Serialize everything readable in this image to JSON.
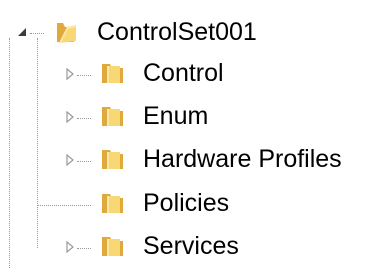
{
  "tree": {
    "root": {
      "label": "ControlSet001",
      "expanded": true,
      "folder_icon": "folder-open-icon"
    },
    "children": [
      {
        "label": "Control",
        "has_children": true,
        "folder_icon": "folder-icon"
      },
      {
        "label": "Enum",
        "has_children": true,
        "folder_icon": "folder-icon"
      },
      {
        "label": "Hardware Profiles",
        "has_children": true,
        "folder_icon": "folder-icon"
      },
      {
        "label": "Policies",
        "has_children": false,
        "folder_icon": "folder-icon"
      },
      {
        "label": "Services",
        "has_children": true,
        "folder_icon": "folder-icon"
      }
    ]
  },
  "colors": {
    "folder_fill": "#f8d775",
    "folder_dark": "#e0a93b",
    "connector": "#9a9a9a",
    "expander": "#9a9a9a",
    "expander_open": "#3c3c3c"
  }
}
